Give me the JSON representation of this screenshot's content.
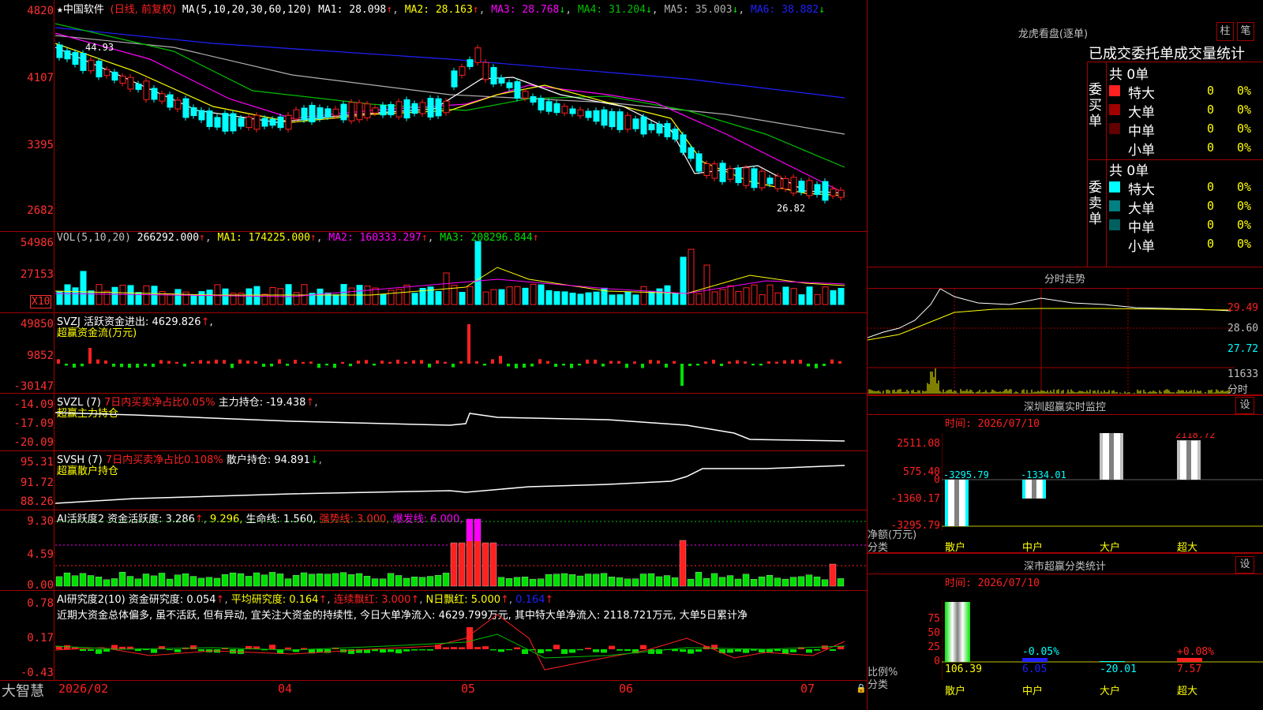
{
  "colors": {
    "up": "#ff2020",
    "down": "#00ffff",
    "ma1": "#ffffff",
    "ma2": "#ffff00",
    "ma3": "#ff00ff",
    "ma4": "#00c000",
    "ma5": "#b0b0b0",
    "ma6": "#2020ff",
    "green": "#00e000",
    "axis": "#a00000"
  },
  "main": {
    "stock_name": "中国软件",
    "period_label": "(日线, 前复权)",
    "ma_params": "MA(5,10,20,30,60,120)",
    "ma1": "MA1: 28.098",
    "ma2": "MA2: 28.163",
    "ma3": "MA3: 28.768",
    "ma4": "MA4: 31.204",
    "ma5": "MA5: 35.003",
    "ma6": "MA6: 38.882",
    "y_ticks": [
      "4820",
      "4107",
      "3395",
      "2682"
    ],
    "high_label": "44.93",
    "low_label": "26.82"
  },
  "vol": {
    "header": "VOL(5,10,20)",
    "value": "266292.000",
    "ma1": "MA1: 174225.000",
    "ma2": "MA2: 160333.297",
    "ma3": "MA3: 208296.844",
    "y_ticks": [
      "54986",
      "27153"
    ],
    "unit": "X10"
  },
  "svzj": {
    "header": "SVZJ  活跃资金进出: 4629.826",
    "sub": "超赢资金流(万元)",
    "y_ticks": [
      "49850",
      "9852",
      "-30147"
    ]
  },
  "svzl": {
    "header_a": "SVZL (7)",
    "header_b": "7日内买卖净占比0.05%",
    "header_c": "主力持仓: -19.438",
    "sub": "超赢主力持仓",
    "y_ticks": [
      "-14.09",
      "-17.09",
      "-20.09"
    ]
  },
  "svsh": {
    "header_a": "SVSH (7)",
    "header_b": "7日内买卖净占比0.108%",
    "header_c": "散户持仓: 94.891",
    "sub": "超赢散户持仓",
    "y_ticks": [
      "95.31",
      "91.72",
      "88.26"
    ]
  },
  "ai1": {
    "a": "AI活跃度2 资金活跃度: 3.286",
    "b": "9.296,",
    "c": "生命线: 1.560,",
    "d": "强势线: 3.000,",
    "e": "爆发线: 6.000,",
    "y_ticks": [
      "9.30",
      "4.59",
      "0.00"
    ]
  },
  "ai2": {
    "a": "AI研究度2(10) 资金研究度: 0.054",
    "b": "平均研究度: 0.164",
    "c": "连续飘红: 3.000",
    "d": "N日飘红: 5.000",
    "e": "0.164",
    "comment": "近期大资金总体偏多, 虽不活跃, 但有异动, 宜关注大资金的持续性, 今日大单净流入: 4629.799万元, 其中特大单净流入: 2118.721万元, 大单5日累计净",
    "y_ticks": [
      "0.78",
      "0.17",
      "-0.43"
    ]
  },
  "xaxis": {
    "brand": "大智慧",
    "labels": [
      "2026/02",
      "04",
      "05",
      "06",
      "07"
    ]
  },
  "dragon": {
    "title": "龙虎看盘(逐单)",
    "btn_a": "柱",
    "btn_b": "笔",
    "subtitle": "已成交委托单成交量统计",
    "buy_label": "委买单",
    "sell_label": "委卖单",
    "buy_total": "共 0单",
    "sell_total": "共 0单",
    "buy_rows": [
      {
        "name": "特大",
        "n": "0",
        "p": "0%"
      },
      {
        "name": "大单",
        "n": "0",
        "p": "0%"
      },
      {
        "name": "中单",
        "n": "0",
        "p": "0%"
      },
      {
        "name": "小单",
        "n": "0",
        "p": "0%"
      }
    ],
    "sell_rows": [
      {
        "name": "特大",
        "n": "0",
        "p": "0%"
      },
      {
        "name": "大单",
        "n": "0",
        "p": "0%"
      },
      {
        "name": "中单",
        "n": "0",
        "p": "0%"
      },
      {
        "name": "小单",
        "n": "0",
        "p": "0%"
      }
    ]
  },
  "intraday": {
    "title": "分时走势",
    "prices": [
      "29.49",
      "28.60",
      "27.72"
    ],
    "vol": "11633",
    "vol_label": "分时"
  },
  "monitor": {
    "title": "深圳超赢实时监控",
    "btn": "设",
    "time": "时间: 2026/07/10",
    "y_ticks": [
      "2511.08",
      "575.40",
      "0",
      "-1360.17",
      "-3295.79"
    ],
    "ylabel": "净额(万元)",
    "xlabel": "分类",
    "cats": [
      "散户",
      "中户",
      "大户",
      "超大"
    ],
    "values": [
      "-3295.79",
      "-1334.01",
      "2511.08",
      "2118.72"
    ]
  },
  "classify": {
    "title": "深市超赢分类统计",
    "btn": "设",
    "time": "时间: 2026/07/10",
    "y_ticks": [
      "75",
      "50",
      "25",
      "0"
    ],
    "ylabel": "比例%",
    "xlabel": "分类",
    "cats": [
      "散户",
      "中户",
      "大户",
      "超大"
    ],
    "top": [
      "",
      "-0.05%",
      "",
      "+0.08%"
    ],
    "bottom": [
      "106.39",
      "6.05",
      "-20.01",
      "7.57"
    ]
  },
  "chart_data": {
    "type": "bar",
    "title": "深圳超赢实时监控",
    "categories": [
      "散户",
      "中户",
      "大户",
      "超大"
    ],
    "values": [
      -3295.79,
      -1334.01,
      2511.08,
      2118.72
    ],
    "ylabel": "净额(万元)",
    "ylim": [
      -3295.79,
      2511.08
    ]
  }
}
